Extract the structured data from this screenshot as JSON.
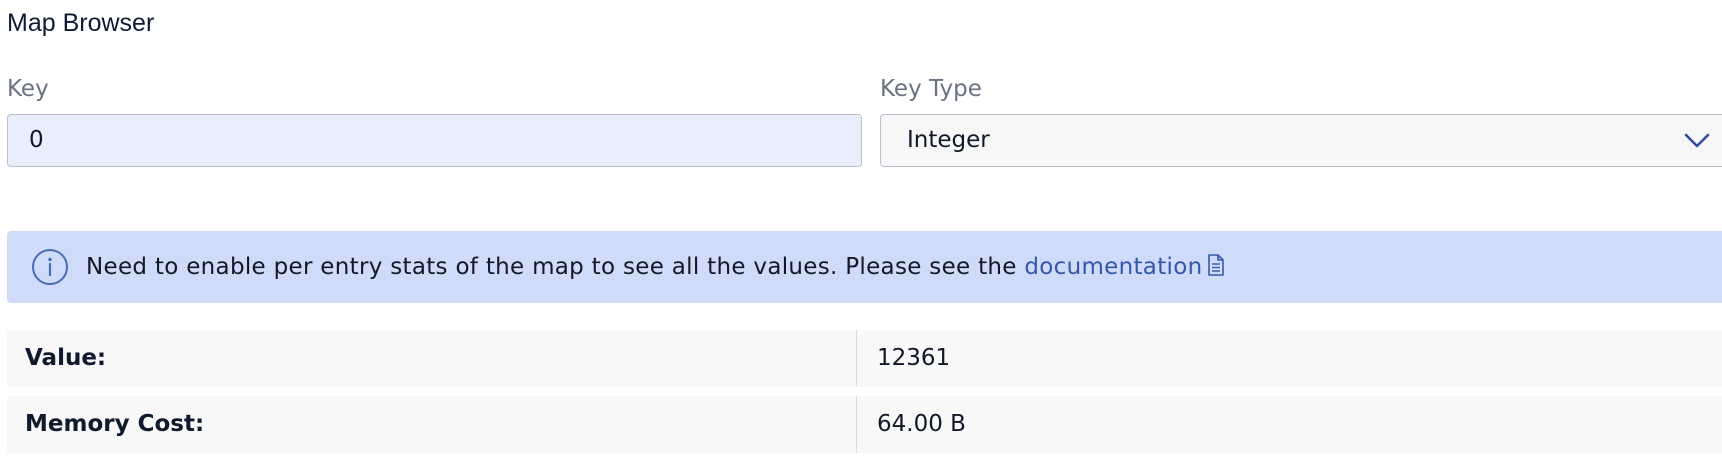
{
  "page": {
    "title": "Map Browser"
  },
  "form": {
    "key_label": "Key",
    "key_value": "0",
    "key_type_label": "Key Type",
    "key_type_value": "Integer"
  },
  "banner": {
    "message": "Need to enable per entry stats of the map to see all the values. Please see the ",
    "link_text": "documentation"
  },
  "details": {
    "rows": [
      {
        "label": "Value:",
        "value": "12361"
      },
      {
        "label": "Memory Cost:",
        "value": "64.00 B"
      }
    ]
  },
  "colors": {
    "accent": "#3457a8",
    "banner_bg": "#cfdbf8",
    "input_bg": "#e8eefc"
  },
  "icons": {
    "info": "info-icon",
    "document": "document-icon",
    "chevron": "chevron-down-icon"
  }
}
